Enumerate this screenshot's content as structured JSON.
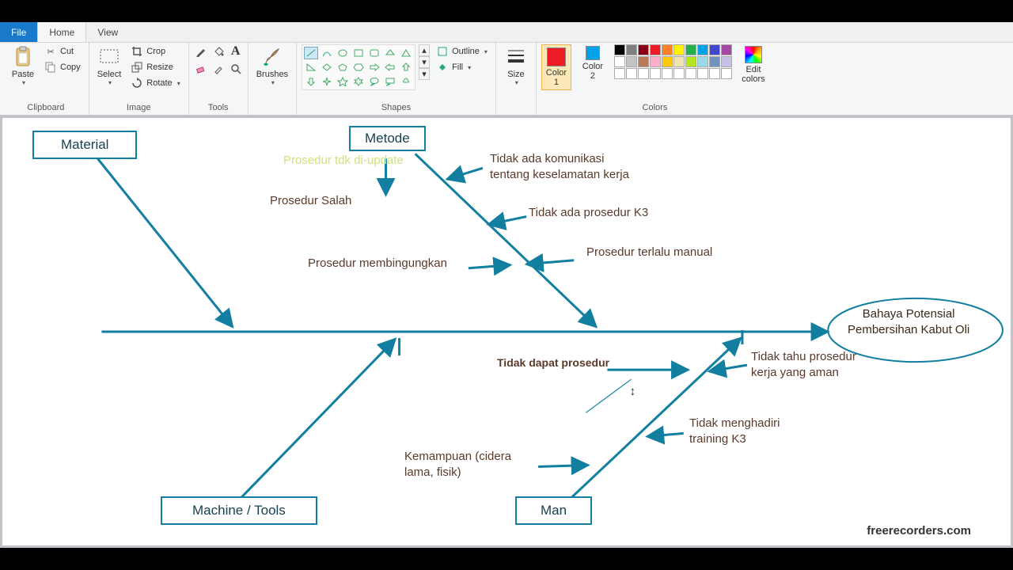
{
  "menu": {
    "file": "File",
    "home": "Home",
    "view": "View"
  },
  "clipboard": {
    "paste": "Paste",
    "cut": "Cut",
    "copy": "Copy",
    "label": "Clipboard"
  },
  "image": {
    "select": "Select",
    "crop": "Crop",
    "resize": "Resize",
    "rotate": "Rotate",
    "label": "Image"
  },
  "tools": {
    "label": "Tools"
  },
  "brushes": {
    "btn": "Brushes"
  },
  "shapes": {
    "outline": "Outline",
    "fill": "Fill",
    "label": "Shapes"
  },
  "size": {
    "btn": "Size"
  },
  "colors": {
    "c1": "Color\n1",
    "c2": "Color\n2",
    "edit": "Edit\ncolors",
    "label": "Colors",
    "row1": [
      "#000",
      "#7f7f7f",
      "#880015",
      "#ed1c24",
      "#ff7f27",
      "#fff200",
      "#22b14c",
      "#00a2e8",
      "#3f48cc",
      "#a349a4"
    ],
    "row2": [
      "#fff",
      "#c3c3c3",
      "#b97a57",
      "#ffaec9",
      "#ffc90e",
      "#efe4b0",
      "#b5e61d",
      "#99d9ea",
      "#7092be",
      "#c8bfe7"
    ],
    "row3": [
      "#fff",
      "#fff",
      "#fff",
      "#fff",
      "#fff",
      "#fff",
      "#fff",
      "#fff",
      "#fff",
      "#fff"
    ]
  },
  "diagram": {
    "cat_material": "Material",
    "cat_metode": "Metode",
    "cat_machine": "Machine / Tools",
    "cat_man": "Man",
    "effect_l1": "Bahaya Potensial",
    "effect_l2": "Pembersihan Kabut Oli",
    "prosedur_tidak_update": "Prosedur tdk di-update",
    "prosedur_salah": "Prosedur Salah",
    "tidak_komunikasi_l1": "Tidak ada komunikasi",
    "tidak_komunikasi_l2": "tentang keselamatan kerja",
    "tidak_prosedur_k3": "Tidak ada prosedur K3",
    "prosedur_bingung": "Prosedur membingungkan",
    "prosedur_manual": "Prosedur terlalu manual",
    "tidak_dapat_prosedur": "Tidak dapat prosedur",
    "tidak_tahu_l1": "Tidak tahu prosedur",
    "tidak_tahu_l2": "kerja yang aman",
    "tidak_hadir_l1": "Tidak menghadiri",
    "tidak_hadir_l2": "training K3",
    "kemampuan_l1": "Kemampuan (cidera",
    "kemampuan_l2": "lama, fisik)",
    "watermark": "freerecorders.com"
  }
}
